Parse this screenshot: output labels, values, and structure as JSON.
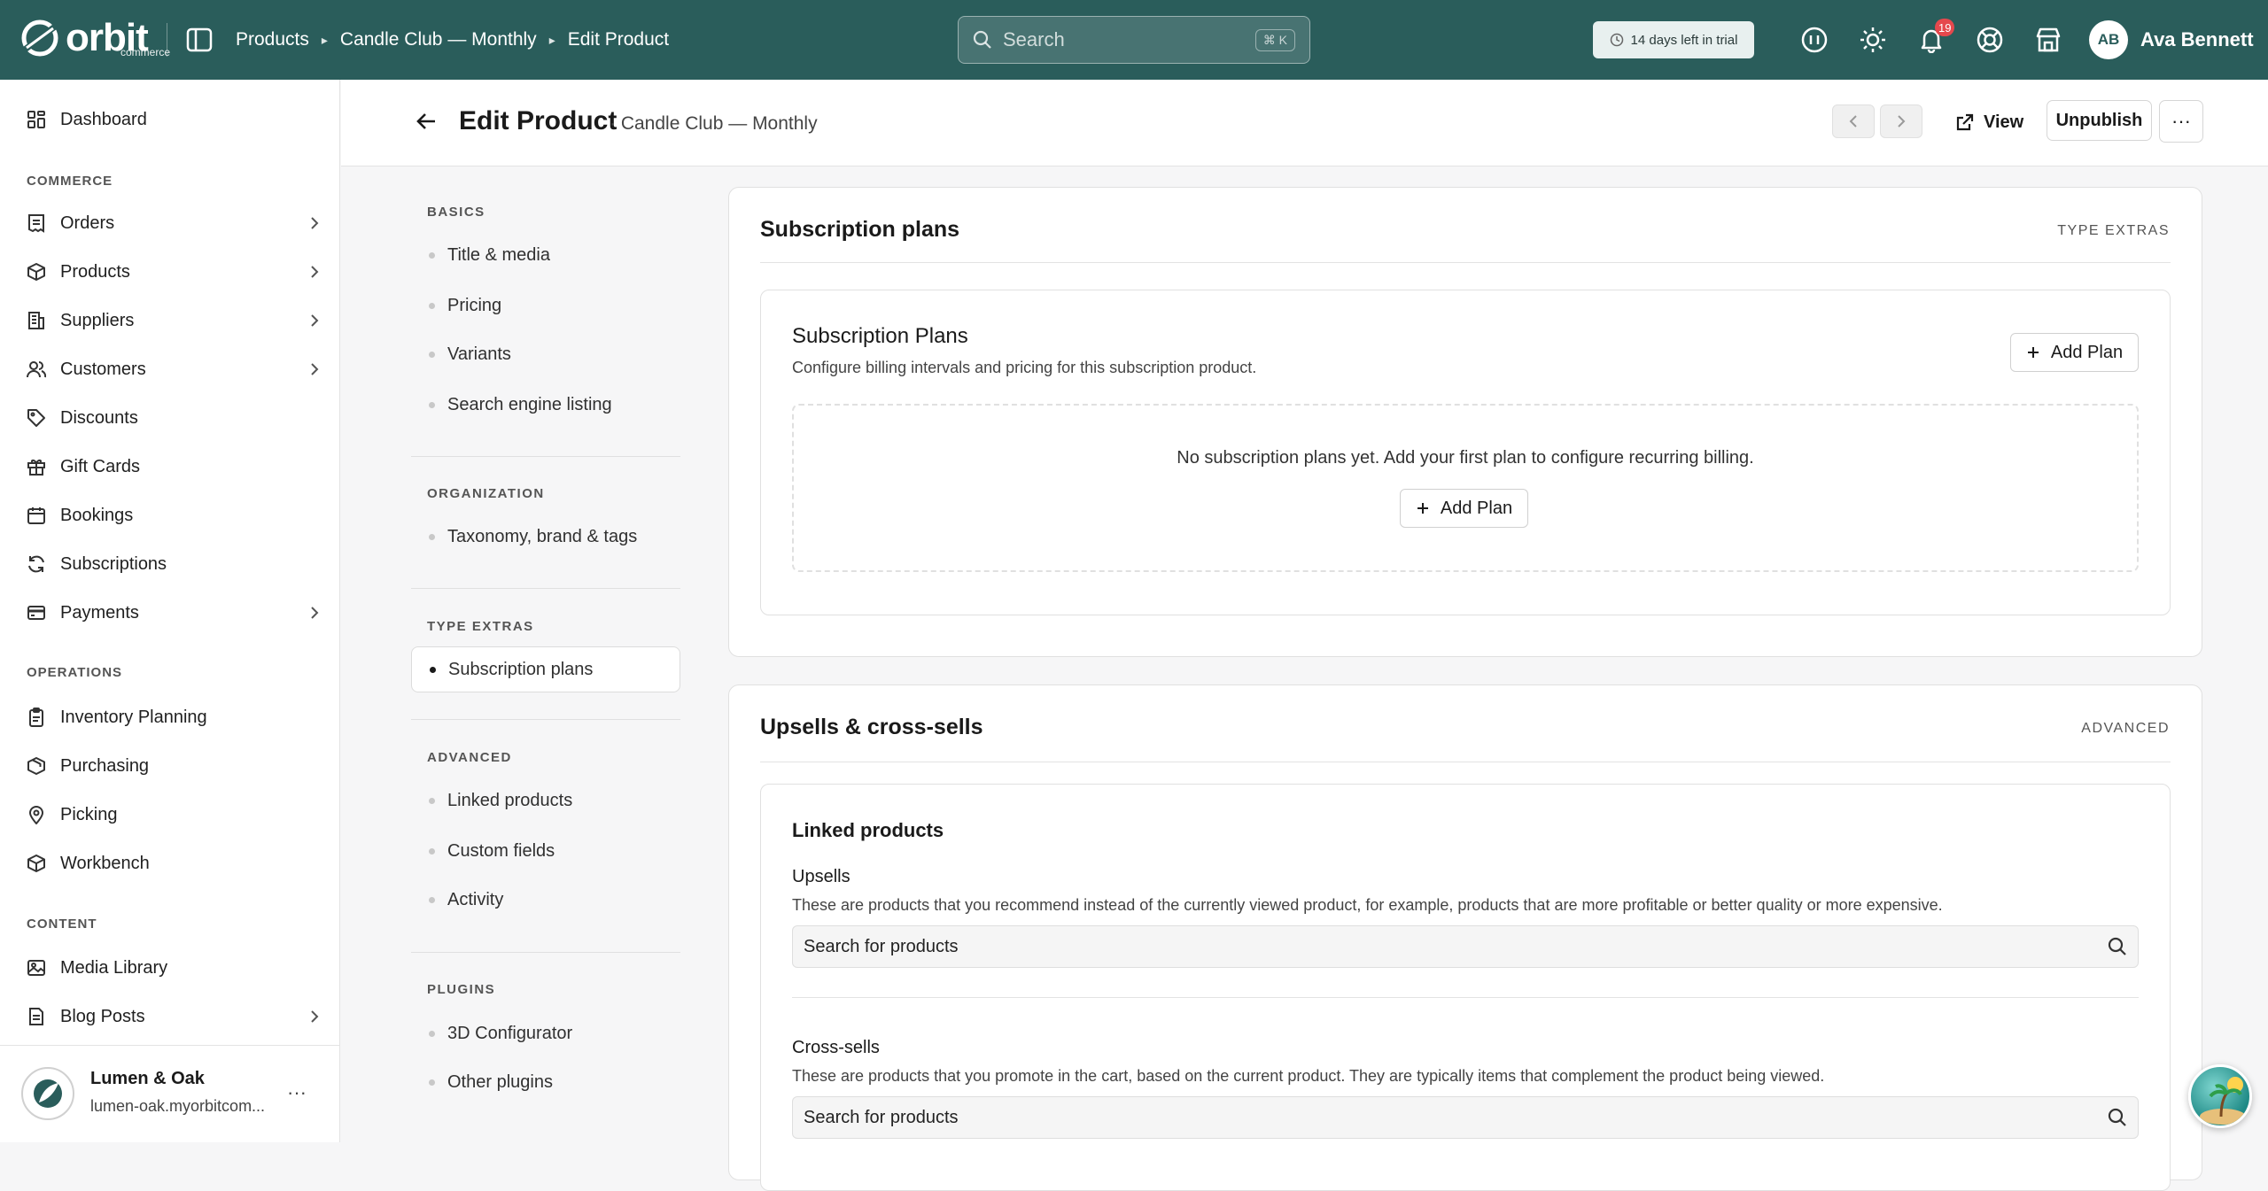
{
  "topbar": {
    "logo_text": "orbit",
    "logo_sub": "commerce",
    "breadcrumbs": [
      "Products",
      "Candle Club — Monthly",
      "Edit Product"
    ],
    "search_placeholder": "Search",
    "search_shortcut": "⌘ K",
    "trial_text": "14 days left in trial",
    "notifications_count": "19",
    "user_initials": "AB",
    "user_name": "Ava Bennett"
  },
  "sidebar": {
    "dashboard": "Dashboard",
    "sections": {
      "commerce": "COMMERCE",
      "operations": "OPERATIONS",
      "content": "CONTENT"
    },
    "commerce_items": [
      "Orders",
      "Products",
      "Suppliers",
      "Customers",
      "Discounts",
      "Gift Cards",
      "Bookings",
      "Subscriptions",
      "Payments"
    ],
    "operations_items": [
      "Inventory Planning",
      "Purchasing",
      "Picking",
      "Workbench"
    ],
    "content_items": [
      "Media Library",
      "Blog Posts"
    ],
    "store": {
      "name": "Lumen & Oak",
      "url": "lumen-oak.myorbitcom..."
    }
  },
  "header": {
    "title": "Edit Product",
    "subtitle": "· Candle Club — Monthly",
    "view_label": "View",
    "unpublish_label": "Unpublish",
    "more_label": "···"
  },
  "section_nav": {
    "basics_label": "BASICS",
    "basics": [
      "Title & media",
      "Pricing",
      "Variants",
      "Search engine listing"
    ],
    "organization_label": "ORGANIZATION",
    "organization": [
      "Taxonomy, brand & tags"
    ],
    "type_extras_label": "TYPE EXTRAS",
    "type_extras": [
      "Subscription plans"
    ],
    "advanced_label": "ADVANCED",
    "advanced": [
      "Linked products",
      "Custom fields",
      "Activity"
    ],
    "plugins_label": "PLUGINS",
    "plugins": [
      "3D Configurator",
      "Other plugins"
    ]
  },
  "subscription_card": {
    "title": "Subscription plans",
    "tag": "TYPE EXTRAS",
    "inner_title": "Subscription Plans",
    "inner_desc": "Configure billing intervals and pricing for this subscription product.",
    "add_plan_label": "Add Plan",
    "empty_text": "No subscription plans yet. Add your first plan to configure recurring billing.",
    "empty_add_label": "Add Plan"
  },
  "upsells_card": {
    "title": "Upsells & cross-sells",
    "tag": "ADVANCED",
    "inner_title": "Linked products",
    "upsells_label": "Upsells",
    "upsells_help": "These are products that you recommend instead of the currently viewed product, for example, products that are more profitable or better quality or more expensive.",
    "upsells_placeholder": "Search for products",
    "crosssells_label": "Cross-sells",
    "crosssells_help": "These are products that you promote in the cart, based on the current product. They are typically items that complement the product being viewed.",
    "crosssells_placeholder": "Search for products"
  },
  "colors": {
    "topbar": "#2a5d5b",
    "badge": "#e5484d"
  }
}
